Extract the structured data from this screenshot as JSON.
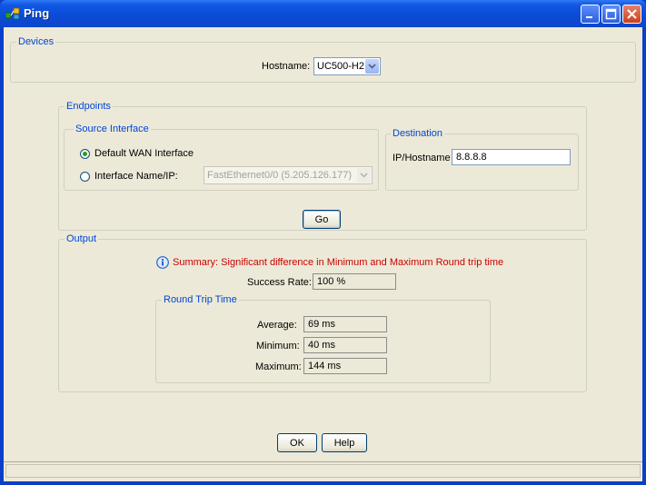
{
  "window": {
    "title": "Ping"
  },
  "devices": {
    "legend": "Devices",
    "hostname_label": "Hostname:",
    "hostname_value": "UC500-H2"
  },
  "endpoints": {
    "legend": "Endpoints",
    "source": {
      "legend": "Source Interface",
      "option_default": "Default WAN Interface",
      "option_named": "Interface Name/IP:",
      "selected": "default",
      "interface_value": "FastEthernet0/0 (5.205.126.177)"
    },
    "destination": {
      "legend": "Destination",
      "label": "IP/Hostname",
      "value": "8.8.8.8"
    }
  },
  "go_label": "Go",
  "output": {
    "legend": "Output",
    "summary": "Summary: Significant difference in Minimum and Maximum Round trip time",
    "success_label": "Success Rate:",
    "success_value": "100 %",
    "rtt": {
      "legend": "Round Trip Time",
      "average_label": "Average:",
      "average_value": "69 ms",
      "minimum_label": "Minimum:",
      "minimum_value": "40 ms",
      "maximum_label": "Maximum:",
      "maximum_value": "144 ms"
    }
  },
  "ok_label": "OK",
  "help_label": "Help",
  "colors": {
    "legend": "#0046d5",
    "summary": "#cc0000",
    "titlebar": "#0a4bd6"
  },
  "icons": {
    "app": "network-ping-icon",
    "info": "info-icon"
  }
}
